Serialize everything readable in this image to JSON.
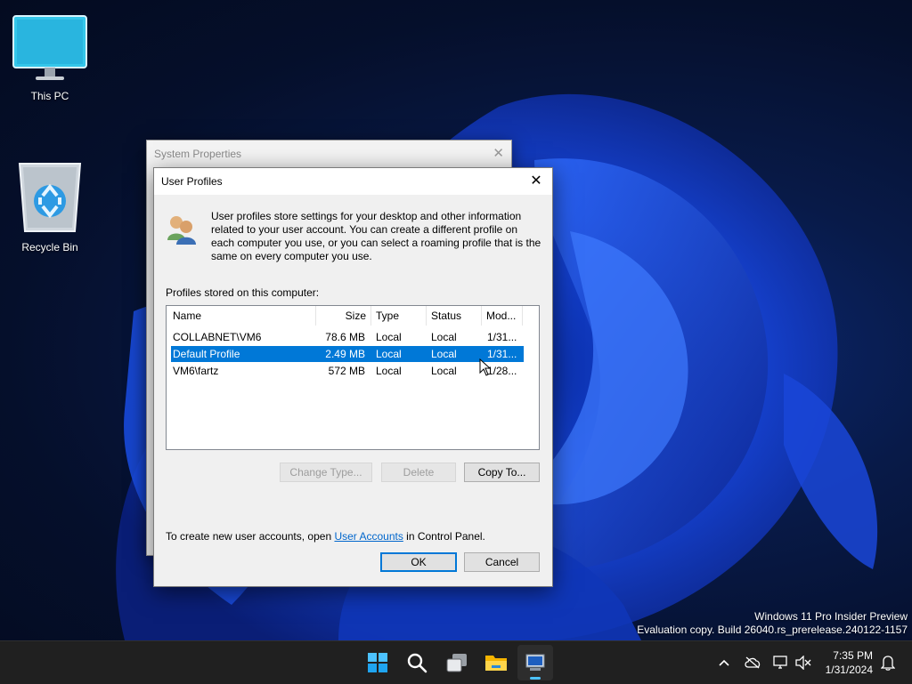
{
  "desktop": {
    "icons": [
      {
        "label": "This PC"
      },
      {
        "label": "Recycle Bin"
      }
    ],
    "watermark": {
      "line1": "Windows 11 Pro Insider Preview",
      "line2": "Evaluation copy. Build 26040.rs_prerelease.240122-1157"
    }
  },
  "background_window": {
    "title": "System Properties",
    "close_glyph": "✕"
  },
  "dialog": {
    "title": "User Profiles",
    "close_glyph": "✕",
    "info_text": "User profiles store settings for your desktop and other information related to your user account. You can create a different profile on each computer you use, or you can select a roaming profile that is the same on every computer you use.",
    "profiles_label": "Profiles stored on this computer:",
    "columns": [
      "Name",
      "Size",
      "Type",
      "Status",
      "Mod..."
    ],
    "rows": [
      {
        "name": "COLLABNET\\VM6",
        "size": "78.6 MB",
        "type": "Local",
        "status": "Local",
        "modified": "1/31..."
      },
      {
        "name": "Default Profile",
        "size": "2.49 MB",
        "type": "Local",
        "status": "Local",
        "modified": "1/31..."
      },
      {
        "name": "VM6\\fartz",
        "size": "572 MB",
        "type": "Local",
        "status": "Local",
        "modified": "1/28..."
      }
    ],
    "selected_row": 1,
    "buttons": {
      "change_type": "Change Type...",
      "delete": "Delete",
      "copy_to": "Copy To...",
      "ok": "OK",
      "cancel": "Cancel"
    },
    "create_note_prefix": "To create new user accounts, open ",
    "create_note_link": "User Accounts",
    "create_note_suffix": " in Control Panel."
  },
  "taskbar": {
    "pinned": [
      "start-icon",
      "search-icon",
      "task-view-icon",
      "file-explorer-icon",
      "system-properties-icon"
    ],
    "tray_icons": [
      "chevron-up-icon",
      "cloud-offline-icon",
      "network-icon",
      "volume-muted-icon",
      "notification-bell-icon"
    ],
    "time": "7:35 PM",
    "date": "1/31/2024"
  },
  "colors": {
    "accent": "#0078d7",
    "link": "#0066cc",
    "taskbar": "#202020"
  }
}
